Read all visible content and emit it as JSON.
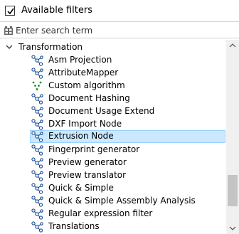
{
  "header": {
    "title": "Available filters",
    "checkbox_checked": true
  },
  "search": {
    "placeholder": "Enter search term",
    "value": ""
  },
  "tree": {
    "group": {
      "label": "Transformation",
      "expanded": true
    },
    "items": [
      {
        "label": "Asm Projection",
        "icon": "filter-node-icon"
      },
      {
        "label": "AttributeMapper",
        "icon": "filter-node-icon"
      },
      {
        "label": "Custom algorithm",
        "icon": "custom-algorithm-icon"
      },
      {
        "label": "Document Hashing",
        "icon": "filter-node-icon"
      },
      {
        "label": "Document Usage Extend",
        "icon": "filter-node-icon"
      },
      {
        "label": "DXF Import Node",
        "icon": "filter-node-icon"
      },
      {
        "label": "Extrusion Node",
        "icon": "filter-node-icon",
        "selected": true
      },
      {
        "label": "Fingerprint generator",
        "icon": "filter-node-icon"
      },
      {
        "label": "Preview generator",
        "icon": "filter-node-icon"
      },
      {
        "label": "Preview translator",
        "icon": "filter-node-icon"
      },
      {
        "label": "Quick & Simple",
        "icon": "filter-node-icon"
      },
      {
        "label": "Quick & Simple Assembly Analysis",
        "icon": "filter-node-icon"
      },
      {
        "label": "Regular expression filter",
        "icon": "filter-node-icon"
      },
      {
        "label": "Translations",
        "icon": "filter-node-icon"
      }
    ]
  },
  "colors": {
    "selection_bg": "#cce8ff",
    "selection_border": "#99d1ff",
    "icon_blue": "#1f4f8f"
  }
}
